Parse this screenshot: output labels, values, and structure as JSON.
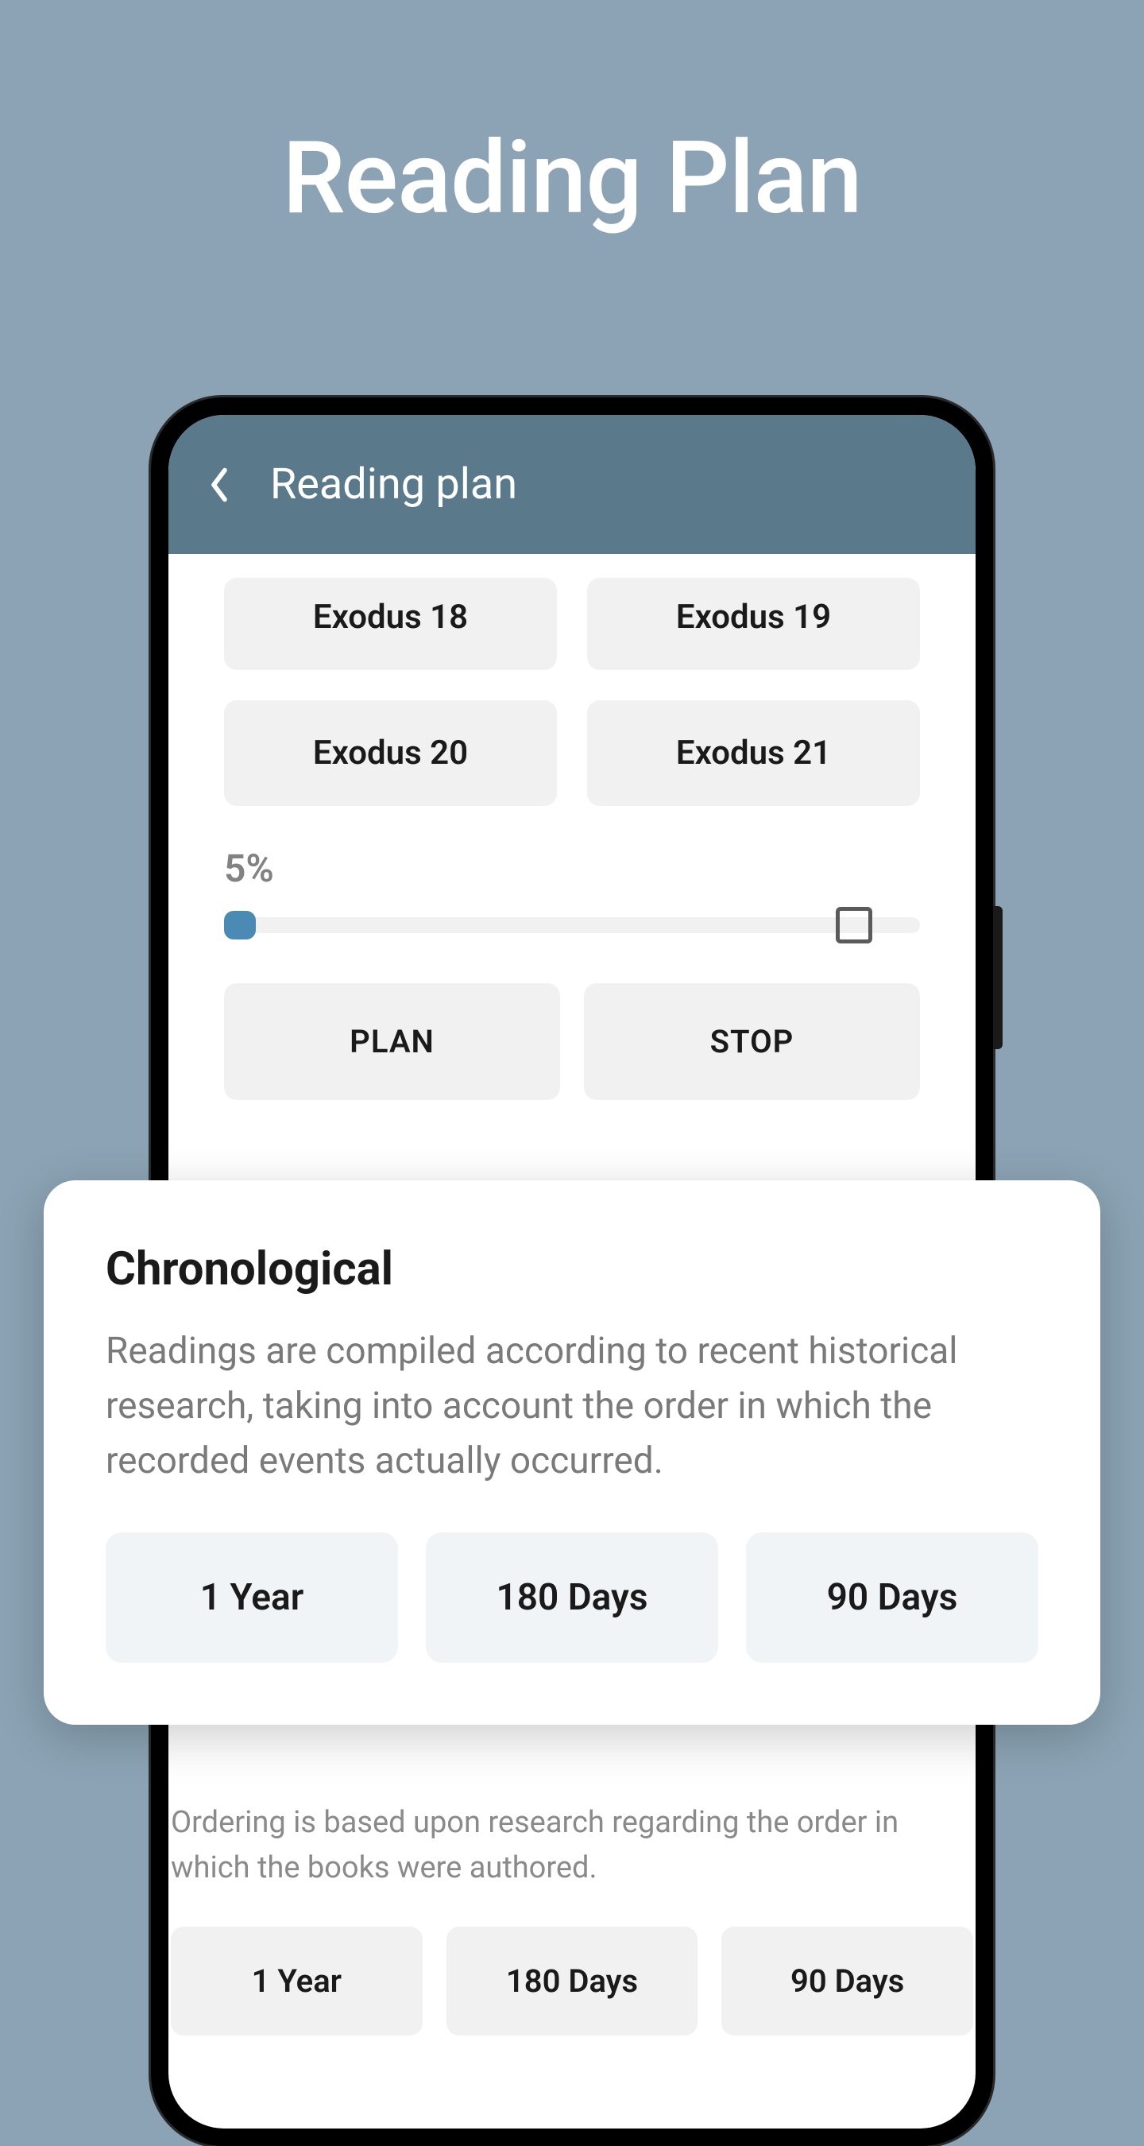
{
  "hero": {
    "title": "Reading Plan"
  },
  "app": {
    "header": {
      "title": "Reading plan"
    },
    "chapters": [
      "Exodus 18",
      "Exodus 19",
      "Exodus 20",
      "Exodus 21"
    ],
    "progress": {
      "percent": "5%"
    },
    "actions": {
      "plan": "PLAN",
      "stop": "STOP"
    }
  },
  "overlay": {
    "title": "Chronological",
    "description": "Readings are compiled according to recent historical research, taking into account the order in which the recorded events actually occurred.",
    "durations": [
      "1 Year",
      "180 Days",
      "90 Days"
    ]
  },
  "lower": {
    "description": "Ordering is based upon research regarding the order in which the books were authored.",
    "durations": [
      "1 Year",
      "180 Days",
      "90 Days"
    ]
  }
}
